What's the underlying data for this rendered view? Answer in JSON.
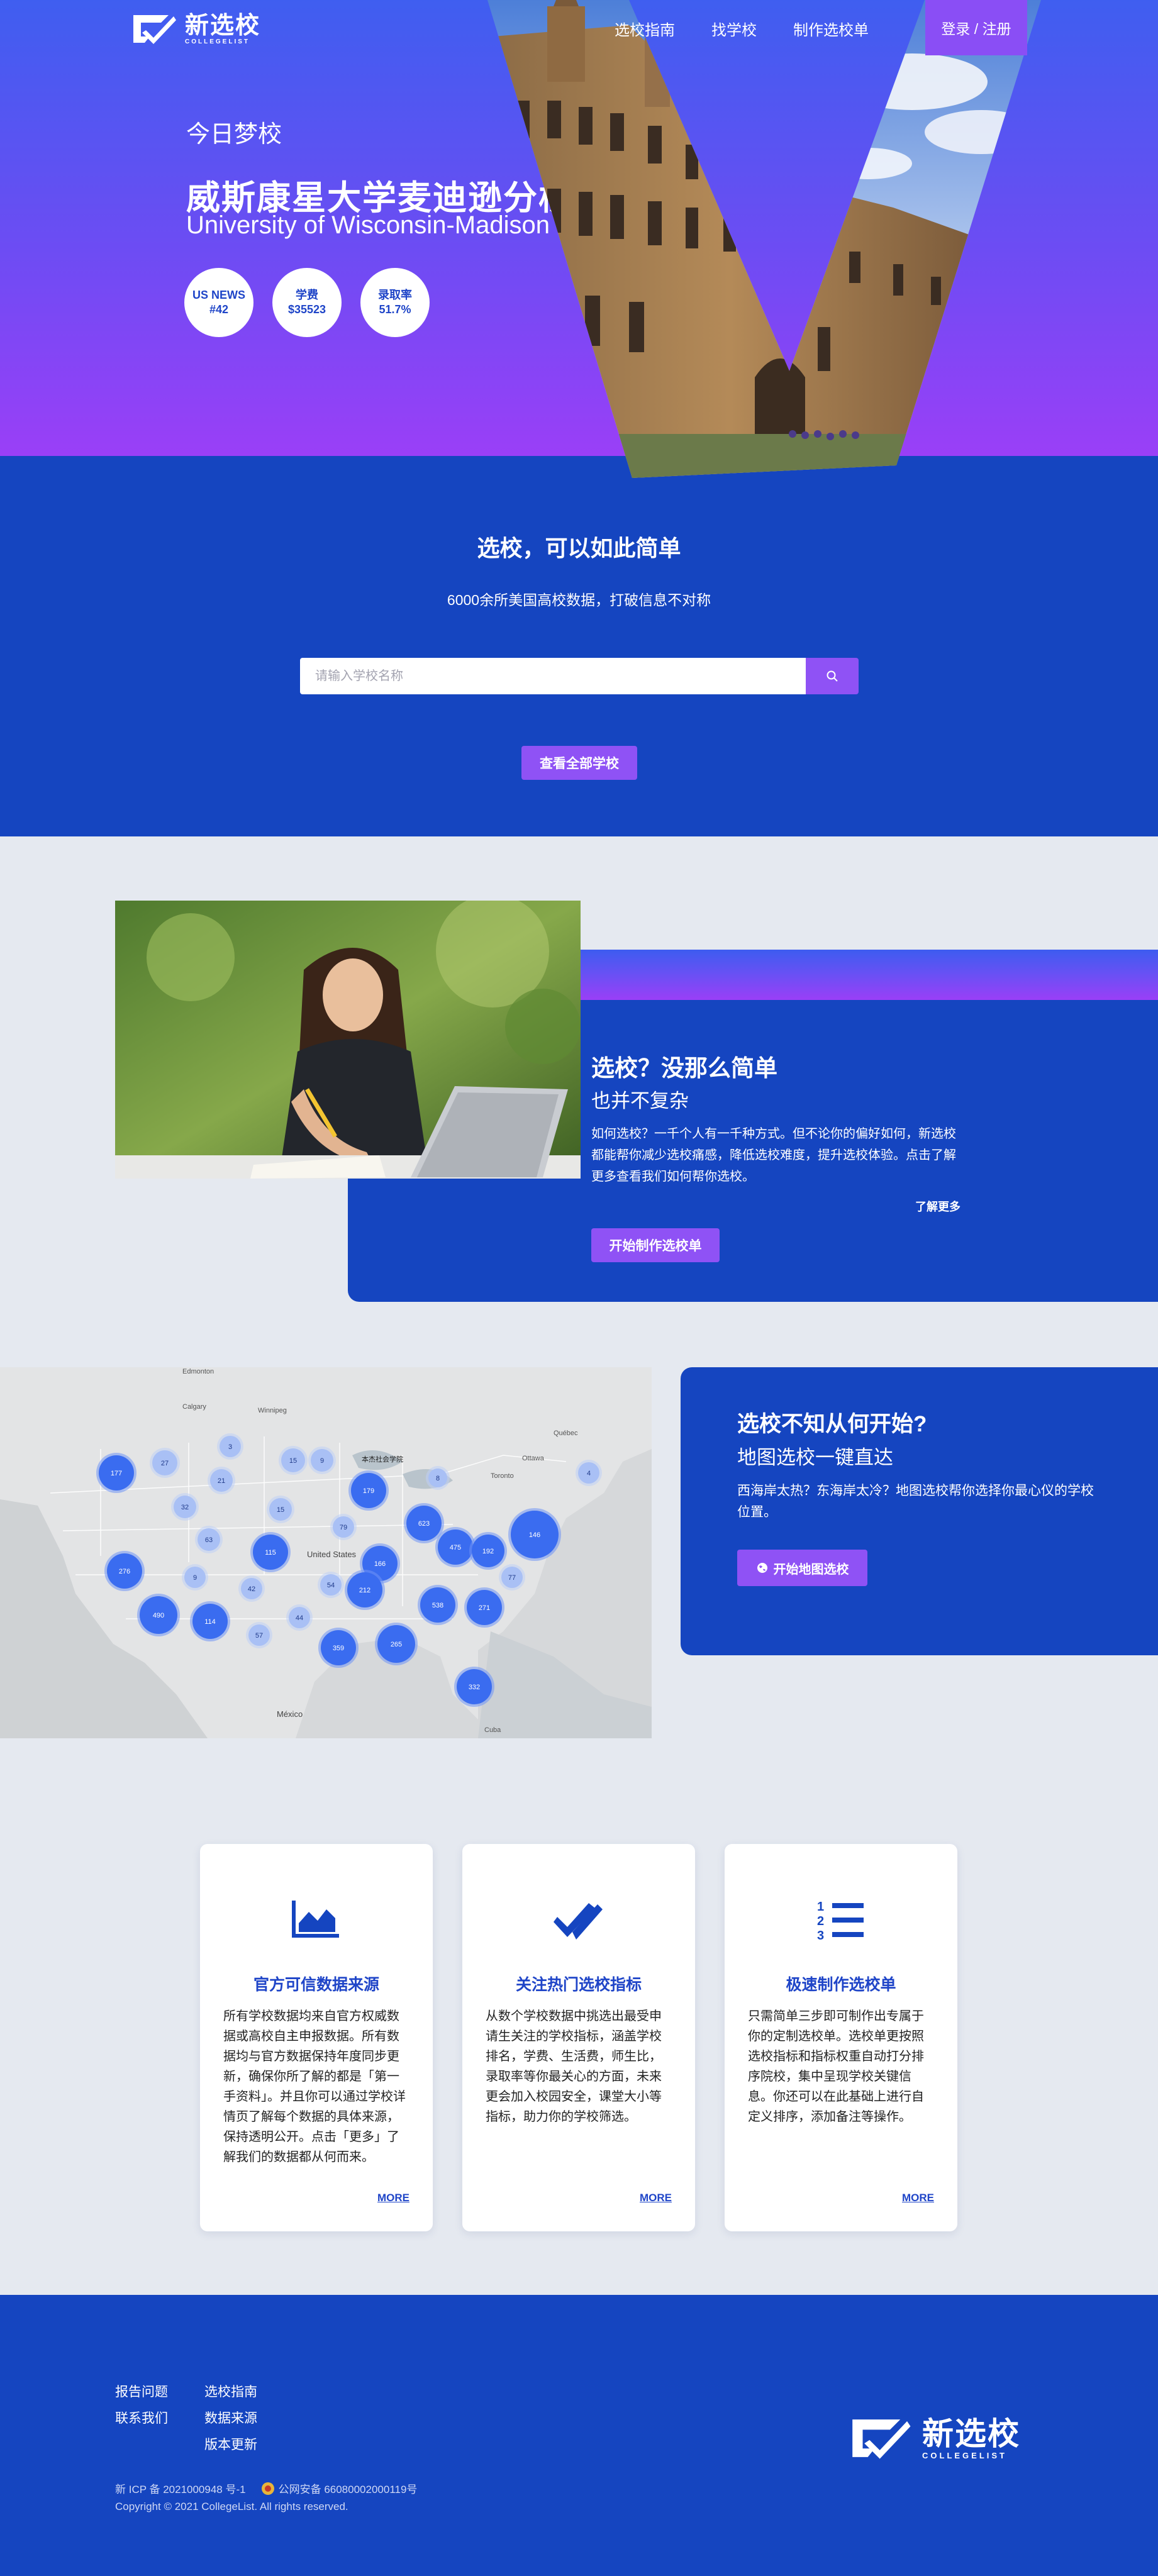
{
  "brand": {
    "name_cn": "新选校",
    "name_en": "COLLEGELIST"
  },
  "nav": {
    "items": [
      "选校指南",
      "找学校",
      "制作选校单"
    ],
    "login": "登录 / 注册"
  },
  "hero": {
    "label": "今日梦校",
    "school_cn": "威斯康星大学麦迪逊分校",
    "school_en": "University of Wisconsin-Madison",
    "stats": [
      {
        "line1": "US NEWS",
        "line2": "#42"
      },
      {
        "line1": "学费",
        "line2": "$35523"
      },
      {
        "line1": "录取率",
        "line2": "51.7%"
      }
    ]
  },
  "search": {
    "title": "选校，可以如此简单",
    "subtitle": "6000余所美国高校数据，打破信息不对称",
    "placeholder": "请输入学校名称",
    "all_button": "查看全部学校"
  },
  "easy": {
    "title": "选校？没那么简单",
    "subtitle": "也并不复杂",
    "text": "如何选校？一千个人有一千种方式。但不论你的偏好如何，新选校都能帮你减少选校痛感，降低选校难度，提升选校体验。点击了解更多查看我们如何帮你选校。",
    "more": "了解更多",
    "button": "开始制作选校单"
  },
  "map_section": {
    "title": "选校不知从何开始?",
    "subtitle": "地图选校一键直达",
    "text": "西海岸太热？东海岸太冷？地图选校帮你选择你最心仪的学校位置。",
    "button": "开始地图选校",
    "labels": {
      "us": "United States",
      "mexico": "México",
      "cuba": "Cuba",
      "school": "本杰社会学院",
      "ottawa": "Ottawa",
      "toronto": "Toronto",
      "winnipeg": "Winnipeg",
      "edmonton": "Edmonton",
      "calgary": "Calgary",
      "quebec": "Québec"
    },
    "clusters": [
      "177",
      "27",
      "3",
      "15",
      "9",
      "21",
      "32",
      "15",
      "179",
      "8",
      "4",
      "79",
      "63",
      "115",
      "166",
      "623",
      "475",
      "192",
      "146",
      "276",
      "9",
      "42",
      "212",
      "54",
      "77",
      "490",
      "114",
      "57",
      "44",
      "538",
      "271",
      "359",
      "265",
      "332"
    ]
  },
  "features": [
    {
      "title": "官方可信数据来源",
      "text": "所有学校数据均来自官方权威数据或高校自主申报数据。所有数据均与官方数据保持年度同步更新，确保你所了解的都是「第一手资料」。并且你可以通过学校详情页了解每个数据的具体来源，保持透明公开。点击「更多」了解我们的数据都从何而来。",
      "more": "MORE"
    },
    {
      "title": "关注热门选校指标",
      "text": "从数个学校数据中挑选出最受申请生关注的学校指标，涵盖学校排名，学费、生活费，师生比，录取率等你最关心的方面，未来更会加入校园安全，课堂大小等指标，助力你的学校筛选。",
      "more": "MORE"
    },
    {
      "title": "极速制作选校单",
      "text": "只需简单三步即可制作出专属于你的定制选校单。选校单更按照选校指标和指标权重自动打分排序院校，集中呈现学校关键信息。你还可以在此基础上进行自定义排序，添加备注等操作。",
      "more": "MORE"
    }
  ],
  "footer": {
    "links": [
      "报告问题",
      "选校指南",
      "联系我们",
      "数据来源",
      "",
      "版本更新"
    ],
    "icp": "新 ICP 备 2021000948 号-1",
    "police": "公网安备 66080002000119号",
    "copyright": "Copyright © 2021 CollegeList. All rights reserved."
  },
  "colors": {
    "primary": "#1545c0",
    "accent": "#8f52f5",
    "hero_top": "#3f5ef0",
    "hero_bottom": "#9a3ff7"
  }
}
